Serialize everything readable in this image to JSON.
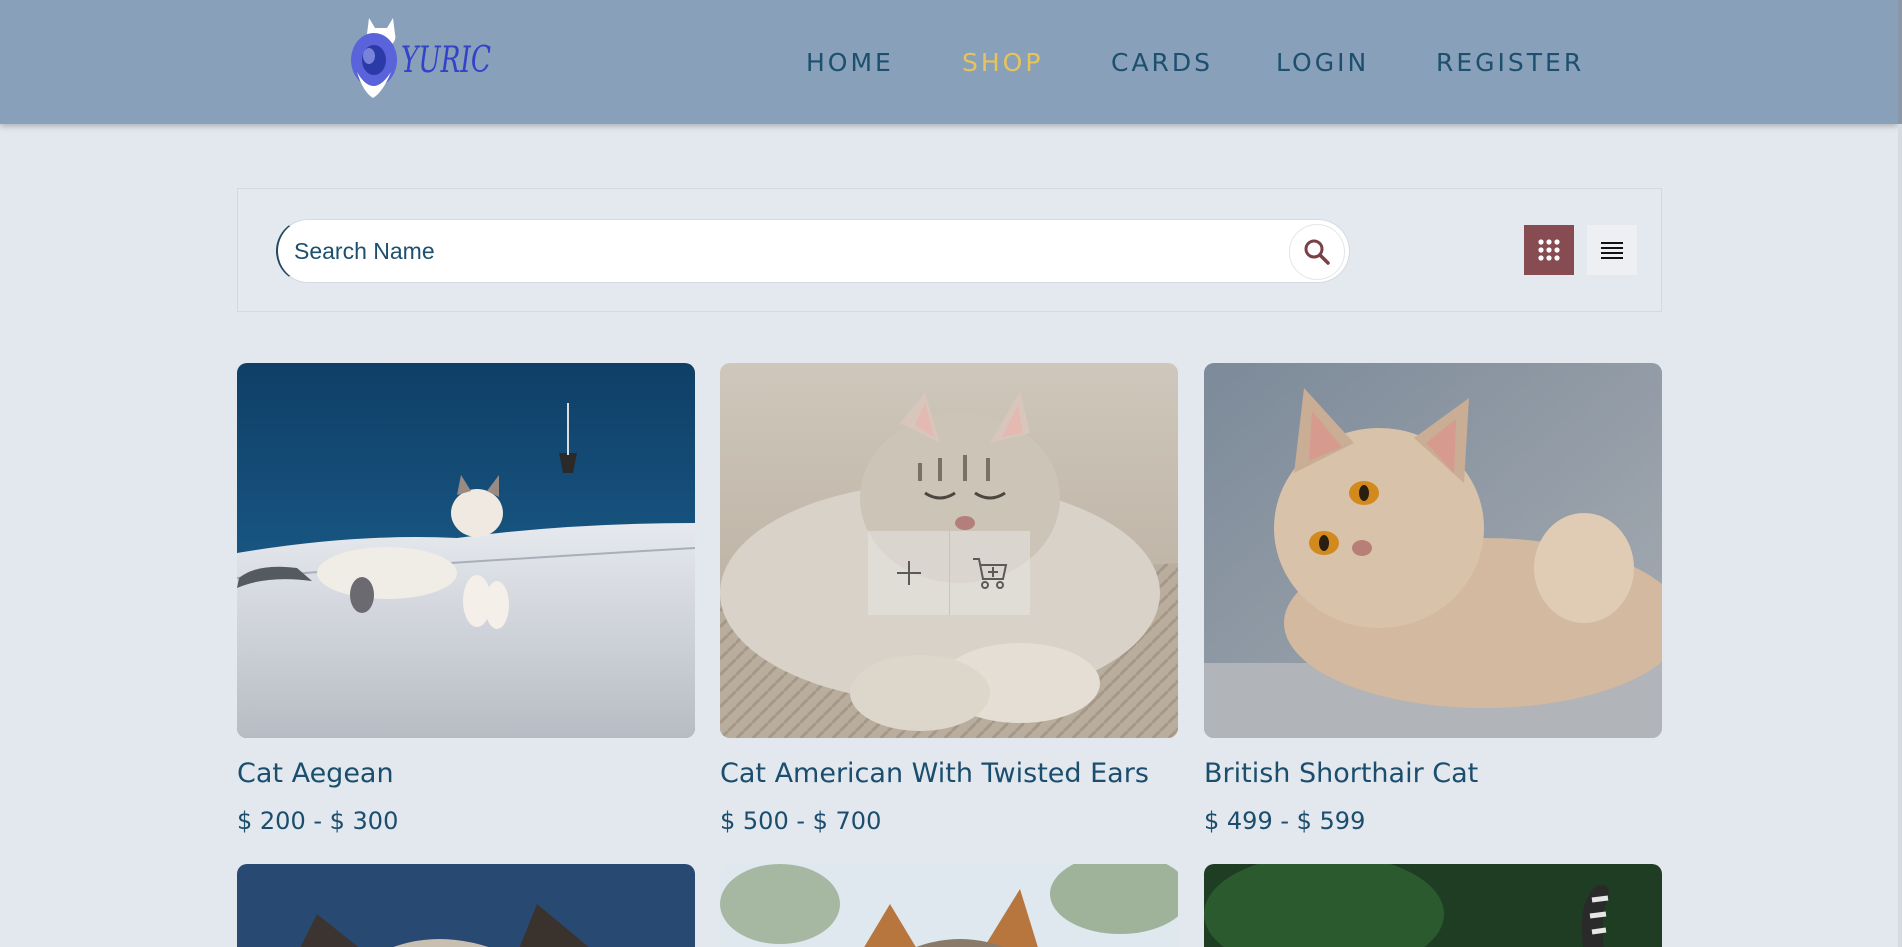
{
  "header": {
    "logo_text": "YURIC",
    "nav": [
      {
        "label": "HOME",
        "active": false
      },
      {
        "label": "SHOP",
        "active": true
      },
      {
        "label": "CARDS",
        "active": false
      },
      {
        "label": "LOGIN",
        "active": false
      },
      {
        "label": "REGISTER",
        "active": false
      }
    ]
  },
  "search": {
    "placeholder": "Search Name",
    "button_icon": "search-icon"
  },
  "view_toggle": {
    "grid_icon": "grid-view-icon",
    "list_icon": "list-view-icon",
    "active": "grid"
  },
  "products": [
    {
      "name": "Cat Aegean",
      "price": "$ 200 - $ 300"
    },
    {
      "name": "Cat American With Twisted Ears",
      "price": "$ 500 - $ 700"
    },
    {
      "name": "British Shorthair Cat",
      "price": "$ 499 - $ 599"
    }
  ],
  "hover_actions": {
    "add_icon": "plus-icon",
    "cart_icon": "add-to-cart-icon"
  },
  "colors": {
    "header_bg": "#88a0ba",
    "nav_text": "#1d4f6e",
    "nav_active": "#e7c45a",
    "page_bg": "#e3e7ee",
    "grid_toggle_active": "#864c52",
    "product_text": "#1b4e6d"
  }
}
